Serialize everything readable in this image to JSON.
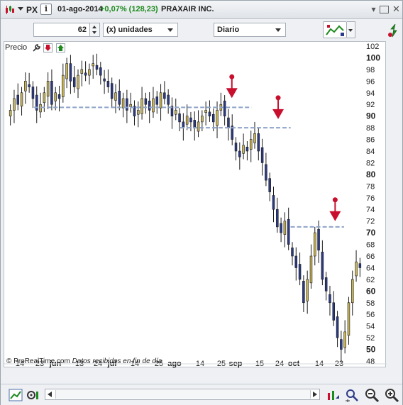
{
  "titlebar": {
    "symbol": "PX",
    "info_icon_text": "i",
    "date": "01-ago-2014",
    "change": "+0,07% (128,23)",
    "name": "PRAXAIR INC.",
    "change_color": "#1c8a1c"
  },
  "toolbar": {
    "quantity": "62",
    "unit_select": "(x) unidades",
    "period_select": "Diario"
  },
  "chart_label": "Precio",
  "copyright": "© ProRealTime.com",
  "source_note": "Datos recibidos en fin de día",
  "chart_data": {
    "type": "candlestick",
    "ylim": [
      48,
      102
    ],
    "y_ticks": [
      "48",
      "50",
      "52",
      "54",
      "56",
      "58",
      "60",
      "62",
      "64",
      "66",
      "68",
      "70",
      "72",
      "74",
      "76",
      "78",
      "80",
      "82",
      "84",
      "86",
      "88",
      "90",
      "92",
      "94",
      "96",
      "98",
      "100",
      "102"
    ],
    "y_ticks_bold": [
      "50",
      "60",
      "70",
      "80",
      "90",
      "100"
    ],
    "x_ticks": [
      "14",
      "23",
      "jun",
      "13",
      "24",
      "jul",
      "14",
      "25",
      "ago",
      "14",
      "25",
      "sep",
      "15",
      "24",
      "oct",
      "14",
      "23"
    ],
    "x_ticks_bold": [
      "jun",
      "jul",
      "ago",
      "sep",
      "oct"
    ],
    "resistance_lines": [
      91.5,
      88,
      71
    ],
    "signal_arrows": 3,
    "closes": [
      91,
      93,
      92,
      94,
      96,
      95,
      93,
      91,
      92,
      94,
      96,
      92,
      94,
      93,
      97,
      99,
      96,
      95,
      97,
      98,
      97,
      98,
      99,
      98,
      97,
      96,
      95,
      93,
      94,
      92,
      93,
      91,
      92,
      90,
      91,
      93,
      92,
      91,
      93,
      92,
      94,
      93,
      92,
      90,
      91,
      89,
      88,
      90,
      89,
      88,
      89,
      90,
      91,
      90,
      89,
      91,
      92,
      90,
      88,
      86,
      84,
      83,
      85,
      84,
      86,
      87,
      84,
      82,
      79,
      77,
      74,
      71,
      70,
      72,
      68,
      66,
      64,
      62,
      58,
      62,
      66,
      70,
      67,
      62,
      60,
      58,
      55,
      52,
      50,
      53,
      58,
      62,
      65,
      64
    ]
  },
  "icons": {
    "window_logo": "candlestick-logo-icon",
    "info": "info-icon",
    "settings": "wrench-icon",
    "sell_indicator": "down-arrow-indicator-icon",
    "buy_indicator": "up-arrow-indicator-icon",
    "chart_tools": "chart-tools-icon",
    "side_tool": "arrows-icon",
    "zoom_in": "zoom-in-icon",
    "zoom_out": "zoom-out-icon",
    "zoom_fit": "zoom-fit-icon"
  },
  "colors": {
    "bull_candle": "#c7b45a",
    "bear_candle": "#2b3a86",
    "signal_arrow": "#c8102e",
    "level_line": "#8fa3c8"
  }
}
